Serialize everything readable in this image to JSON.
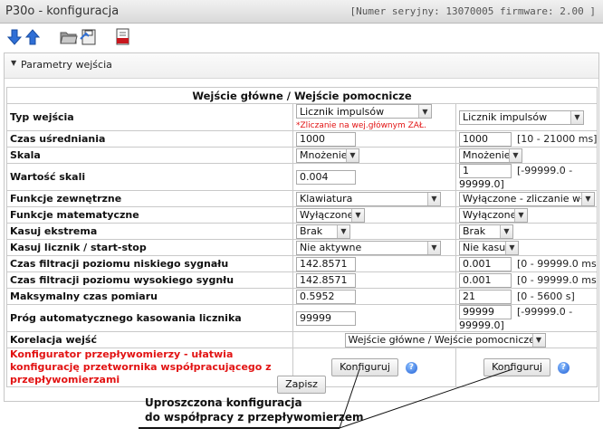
{
  "window": {
    "title": "P30o - konfiguracja",
    "serial": "[Numer seryjny: 13070005 firmware: 2.00 ]"
  },
  "toolbar": {
    "icons": [
      "arrow-down-icon",
      "arrow-up-icon",
      "folder-open-icon",
      "save-icon",
      "pdf-icon"
    ]
  },
  "panel": {
    "title": "Parametry wejścia",
    "table_header": "Wejście główne / Wejście pomocnicze",
    "rows": {
      "typ": {
        "label": "Typ wejścia",
        "main": "Licznik impulsów",
        "note": "*Zliczanie na wej.głównym ZAŁ.",
        "aux": "Licznik impulsów"
      },
      "usred": {
        "label": "Czas uśredniania",
        "main": "1000",
        "aux": "1000",
        "range": "[10 - 21000 ms]"
      },
      "skala": {
        "label": "Skala",
        "main": "Mnożenie",
        "aux": "Mnożenie"
      },
      "wskala": {
        "label": "Wartość skali",
        "main": "0.004",
        "aux": "1",
        "range1": "[-99999.0 -",
        "range2": "99999.0]"
      },
      "fzew": {
        "label": "Funkcje zewnętrzne",
        "main": "Klawiatura",
        "aux": "Wyłączone - zliczanie włą…"
      },
      "fmat": {
        "label": "Funkcje matematyczne",
        "main": "Wyłączone",
        "aux": "Wyłączone"
      },
      "kasext": {
        "label": "Kasuj ekstrema",
        "main": "Brak",
        "aux": "Brak"
      },
      "kaslicz": {
        "label": "Kasuj licznik / start-stop",
        "main": "Nie aktywne",
        "aux": "Nie kasuj"
      },
      "fnis": {
        "label": "Czas filtracji poziomu niskiego sygnału",
        "main": "142.8571",
        "aux": "0.001",
        "range": "[0 - 99999.0 ms]"
      },
      "fwys": {
        "label": "Czas filtracji poziomu wysokiego sygnłu",
        "main": "142.8571",
        "aux": "0.001",
        "range": "[0 - 99999.0 ms]"
      },
      "maxczas": {
        "label": "Maksymalny czas pomiaru",
        "main": "0.5952",
        "aux": "21",
        "range": "[0 - 5600 s]"
      },
      "prog": {
        "label": "Próg automatycznego kasowania licznika",
        "main": "99999",
        "aux": "99999",
        "range1": "[-99999.0 -",
        "range2": "99999.0]"
      },
      "korel": {
        "label": "Korelacja wejść",
        "value": "Wejście główne / Wejście pomocnicze"
      },
      "konfig": {
        "label": "Konfigurator przepływomierzy - ułatwia konfigurację przetwornika współpracującego z przepływomierzami",
        "button": "Konfiguruj",
        "help": "?"
      }
    },
    "save_label": "Zapisz"
  },
  "annotation": {
    "line1": "Uproszczona konfiguracja",
    "line2": "do współpracy z przepływomierzem"
  }
}
